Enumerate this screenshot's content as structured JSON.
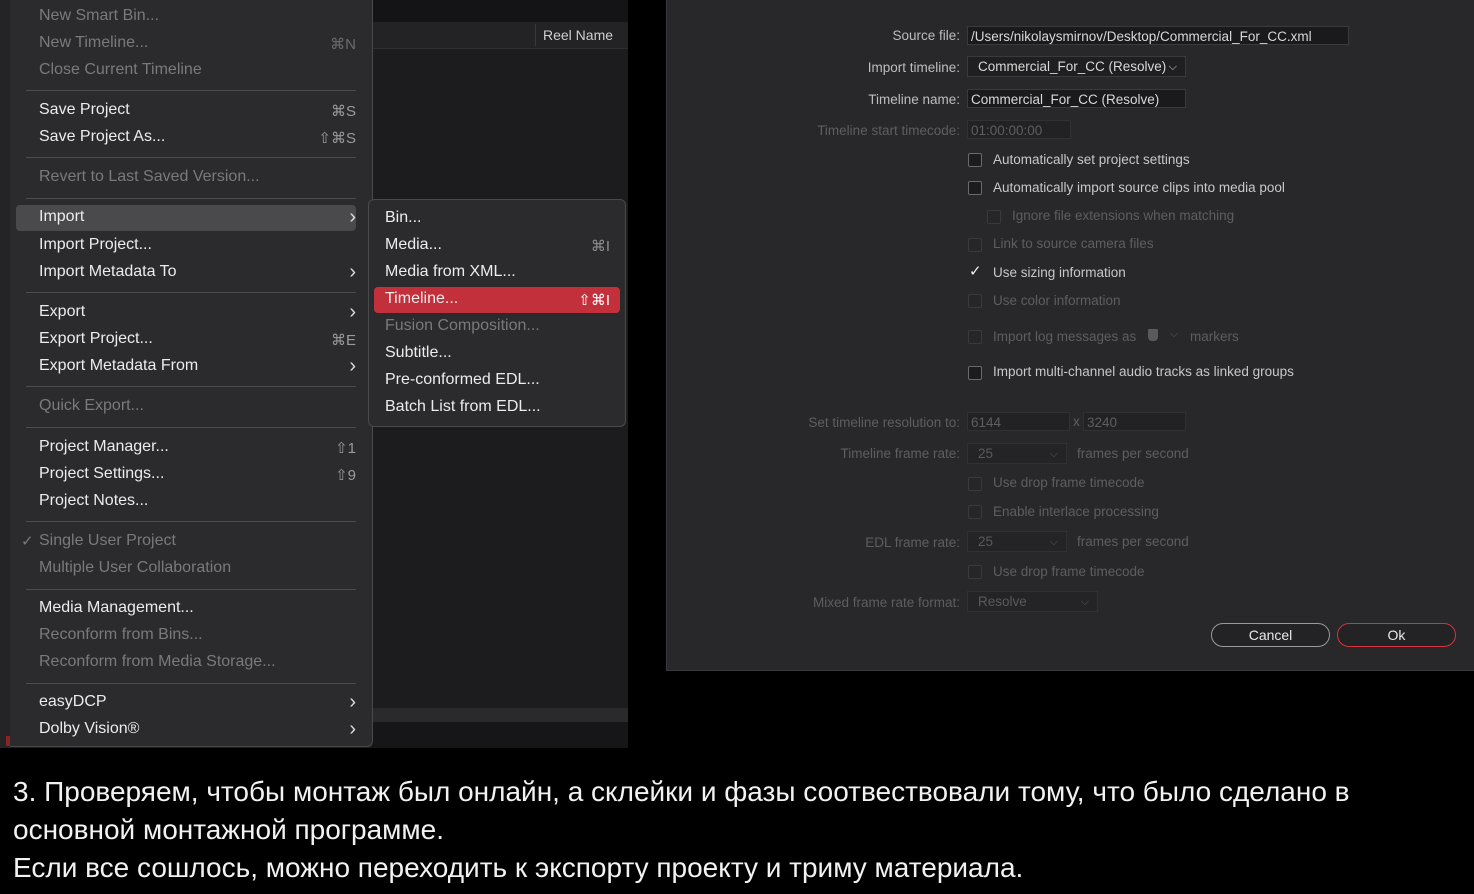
{
  "background_panel": {
    "column_header": "Reel Name"
  },
  "main_menu": {
    "items": [
      {
        "label": "New Smart Bin...",
        "shortcut": "",
        "disabled": true
      },
      {
        "label": "New Timeline...",
        "shortcut": "⌘N",
        "disabled": true
      },
      {
        "label": "Close Current Timeline",
        "shortcut": "",
        "disabled": true
      },
      {
        "label": "Save Project",
        "shortcut": "⌘S",
        "disabled": false
      },
      {
        "label": "Save Project As...",
        "shortcut": "⇧⌘S",
        "disabled": false
      },
      {
        "label": "Revert to Last Saved Version...",
        "shortcut": "",
        "disabled": true
      },
      {
        "label": "Import",
        "shortcut": "",
        "disabled": false,
        "submenu": true,
        "highlighted": true
      },
      {
        "label": "Import Project...",
        "shortcut": "",
        "disabled": false
      },
      {
        "label": "Import Metadata To",
        "shortcut": "",
        "disabled": false,
        "submenu": true
      },
      {
        "label": "Export",
        "shortcut": "",
        "disabled": false,
        "submenu": true
      },
      {
        "label": "Export Project...",
        "shortcut": "⌘E",
        "disabled": false
      },
      {
        "label": "Export Metadata From",
        "shortcut": "",
        "disabled": false,
        "submenu": true
      },
      {
        "label": "Quick Export...",
        "shortcut": "",
        "disabled": true
      },
      {
        "label": "Project Manager...",
        "shortcut": "⇧1",
        "disabled": false
      },
      {
        "label": "Project Settings...",
        "shortcut": "⇧9",
        "disabled": false
      },
      {
        "label": "Project Notes...",
        "shortcut": "",
        "disabled": false
      },
      {
        "label": "Single User Project",
        "shortcut": "",
        "disabled": true,
        "checked": true
      },
      {
        "label": "Multiple User Collaboration",
        "shortcut": "",
        "disabled": true
      },
      {
        "label": "Media Management...",
        "shortcut": "",
        "disabled": false
      },
      {
        "label": "Reconform from Bins...",
        "shortcut": "",
        "disabled": true
      },
      {
        "label": "Reconform from Media Storage...",
        "shortcut": "",
        "disabled": true
      },
      {
        "label": "easyDCP",
        "shortcut": "",
        "disabled": false,
        "submenu": true
      },
      {
        "label": "Dolby Vision®",
        "shortcut": "",
        "disabled": false,
        "submenu": true
      }
    ],
    "submenu_arrow": "›",
    "check_mark": "✓"
  },
  "import_submenu": {
    "items": [
      {
        "label": "Bin...",
        "shortcut": "",
        "disabled": false
      },
      {
        "label": "Media...",
        "shortcut": "⌘I",
        "disabled": false
      },
      {
        "label": "Media from XML...",
        "shortcut": "",
        "disabled": false
      },
      {
        "label": "Timeline...",
        "shortcut": "⇧⌘I",
        "disabled": false,
        "selected": true
      },
      {
        "label": "Fusion Composition...",
        "shortcut": "",
        "disabled": true
      },
      {
        "label": "Subtitle...",
        "shortcut": "",
        "disabled": false
      },
      {
        "label": "Pre-conformed EDL...",
        "shortcut": "",
        "disabled": false
      },
      {
        "label": "Batch List from EDL...",
        "shortcut": "",
        "disabled": false
      }
    ]
  },
  "dialog": {
    "source_file_label": "Source file:",
    "source_file_value": "/Users/nikolaysmirnov/Desktop/Commercial_For_CC.xml",
    "import_timeline_label": "Import timeline:",
    "import_timeline_value": "Commercial_For_CC (Resolve)",
    "timeline_name_label": "Timeline name:",
    "timeline_name_value": "Commercial_For_CC (Resolve)",
    "start_tc_label": "Timeline start timecode:",
    "start_tc_value": "01:00:00:00",
    "options": [
      {
        "label": "Automatically set project settings",
        "checked": false,
        "disabled": false
      },
      {
        "label": "Automatically import source clips into media pool",
        "checked": false,
        "disabled": false
      },
      {
        "label": "Ignore file extensions when matching",
        "checked": false,
        "disabled": true
      },
      {
        "label": "Link to source camera files",
        "checked": false,
        "disabled": true
      },
      {
        "label": "Use sizing information",
        "checked": true,
        "disabled": false
      },
      {
        "label": "Use color information",
        "checked": false,
        "disabled": true
      }
    ],
    "log_messages_label": "Import log messages as",
    "log_messages_suffix": "markers",
    "multichannel_label": "Import multi-channel audio tracks as linked groups",
    "resolution_label": "Set timeline resolution to:",
    "resolution_w": "6144",
    "resolution_x": "x",
    "resolution_h": "3240",
    "frame_rate_label": "Timeline frame rate:",
    "frame_rate_value": "25",
    "fps_suffix": "frames per second",
    "drop_frame_label": "Use drop frame timecode",
    "interlace_label": "Enable interlace processing",
    "edl_rate_label": "EDL frame rate:",
    "edl_rate_value": "25",
    "edl_fps_suffix": "frames per second",
    "edl_drop_frame_label": "Use drop frame timecode",
    "mixed_rate_label": "Mixed frame rate format:",
    "mixed_rate_value": "Resolve",
    "cancel_label": "Cancel",
    "ok_label": "Ok",
    "chevron": "⌵",
    "tick": "✓"
  },
  "caption": {
    "line1": "3. Проверяем, чтобы монтаж был онлайн, а склейки и фазы соотвествовали тому, что было сделано в",
    "line2": "основной монтажной программе.",
    "line3": "Если все сошлось,  можно переходить к экспорту проекту и триму материала."
  },
  "colors": {
    "menu_bg": "#2b2b2d",
    "selected": "#c2303c",
    "ok_border": "#d4343c",
    "dialog_bg": "#28282a"
  }
}
